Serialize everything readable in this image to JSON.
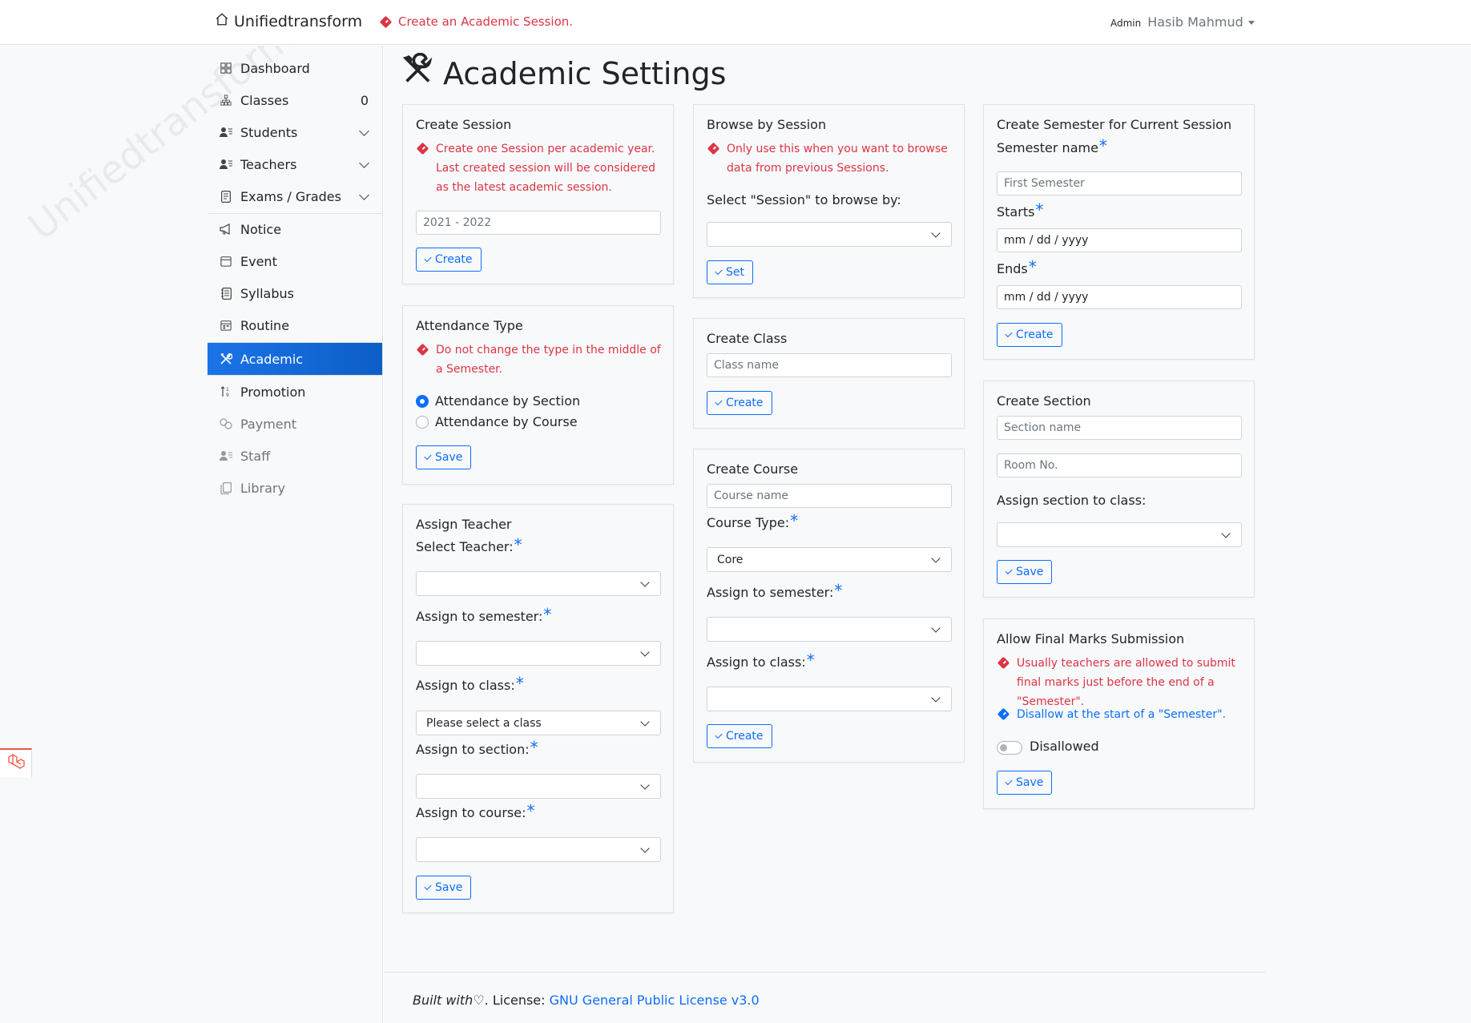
{
  "navbar": {
    "brand": "Unifiedtransform",
    "alert": "Create an Academic Session.",
    "role": "Admin",
    "user_name": "Hasib Mahmud"
  },
  "sidebar": {
    "watermark": "Unifiedtransform",
    "items": [
      {
        "label": "Dashboard",
        "icon": "grid-icon"
      },
      {
        "label": "Classes",
        "icon": "diagram-icon",
        "count": "0"
      },
      {
        "label": "Students",
        "icon": "person-lines-icon"
      },
      {
        "label": "Teachers",
        "icon": "person-lines-icon"
      },
      {
        "label": "Exams / Grades",
        "icon": "file-text-icon"
      },
      {
        "label": "Notice",
        "icon": "megaphone-icon"
      },
      {
        "label": "Event",
        "icon": "calendar-icon"
      },
      {
        "label": "Syllabus",
        "icon": "journal-icon"
      },
      {
        "label": "Routine",
        "icon": "calendar-week-icon"
      },
      {
        "label": "Academic",
        "icon": "tools-icon"
      },
      {
        "label": "Promotion",
        "icon": "sort-numeric-icon"
      },
      {
        "label": "Payment",
        "icon": "cash-coin-icon"
      },
      {
        "label": "Staff",
        "icon": "person-lines-icon"
      },
      {
        "label": "Library",
        "icon": "journals-icon"
      }
    ]
  },
  "page": {
    "title": "Academic Settings"
  },
  "create_session": {
    "title": "Create Session",
    "warning": "Create one Session per academic year. Last created session will be considered as the latest academic session.",
    "placeholder": "2021 - 2022",
    "button": "Create"
  },
  "attendance": {
    "title": "Attendance Type",
    "warning": "Do not change the type in the middle of a Semester.",
    "option1": "Attendance by Section",
    "option2": "Attendance by Course",
    "button": "Save"
  },
  "assign_teacher": {
    "title": "Assign Teacher",
    "teacher_label": "Select Teacher:",
    "semester_label": "Assign to semester:",
    "class_label": "Assign to class:",
    "class_value": "Please select a class",
    "section_label": "Assign to section:",
    "course_label": "Assign to course:",
    "button": "Save"
  },
  "browse_session": {
    "title": "Browse by Session",
    "warning": "Only use this when you want to browse data from previous Sessions.",
    "label": "Select \"Session\" to browse by:",
    "button": "Set"
  },
  "create_class": {
    "title": "Create Class",
    "placeholder": "Class name",
    "button": "Create"
  },
  "create_course": {
    "title": "Create Course",
    "placeholder": "Course name",
    "type_label": "Course Type:",
    "type_value": "Core",
    "semester_label": "Assign to semester:",
    "class_label": "Assign to class:",
    "button": "Create"
  },
  "create_semester": {
    "title": "Create Semester for Current Session",
    "name_label": "Semester name",
    "name_placeholder": "First Semester",
    "starts_label": "Starts",
    "starts_value": "mm / dd / yyyy",
    "ends_label": "Ends",
    "ends_value": "mm / dd / yyyy",
    "button": "Create"
  },
  "create_section": {
    "title": "Create Section",
    "name_placeholder": "Section name",
    "room_placeholder": "Room No.",
    "class_label": "Assign section to class:",
    "button": "Save"
  },
  "final_marks": {
    "title": "Allow Final Marks Submission",
    "warning": "Usually teachers are allowed to submit final marks just before the end of a \"Semester\".",
    "info": "Disallow at the start of a \"Semester\".",
    "switch_label": "Disallowed",
    "button": "Save"
  },
  "footer": {
    "built": "Built with",
    "license_prefix": ". License: ",
    "license_link": "GNU General Public License v3.0"
  },
  "colors": {
    "primary": "#0d6efd",
    "danger": "#dc3545",
    "background": "#f8f9fa"
  }
}
